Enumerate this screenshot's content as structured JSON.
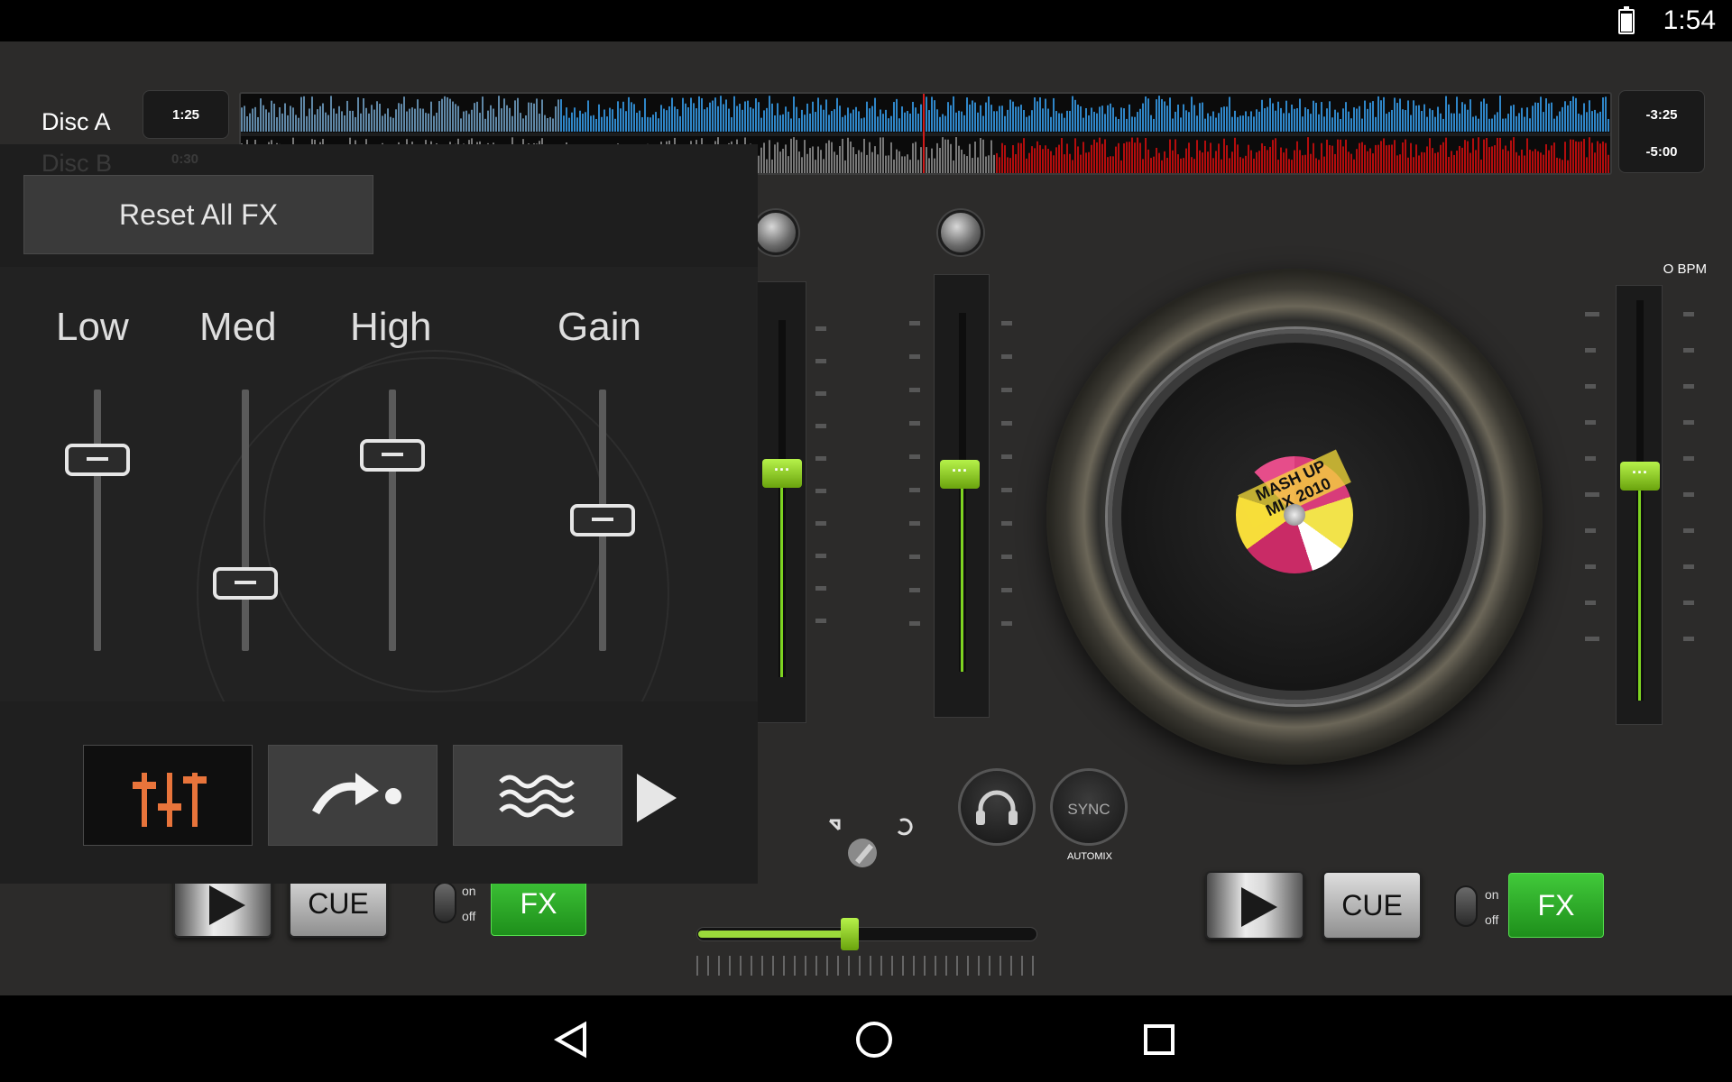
{
  "status_bar": {
    "time": "1:54"
  },
  "deck_a": {
    "name": "Disc A",
    "time_elapsed": "1:25",
    "time_remaining": "-3:25"
  },
  "deck_b": {
    "name": "Disc B",
    "time_elapsed": "0:30",
    "time_remaining": "-5:00",
    "bpm": "O BPM"
  },
  "fx_panel": {
    "reset_label": "Reset All FX",
    "eq_bands": [
      {
        "label": "Low",
        "level": 0.27
      },
      {
        "label": "Med",
        "level": 0.74
      },
      {
        "label": "High",
        "level": 0.25
      },
      {
        "label": "Gain",
        "level": 0.5
      }
    ],
    "tools": [
      {
        "icon": "eq-sliders-icon",
        "active": true
      },
      {
        "icon": "loop-arrow-icon",
        "active": false
      },
      {
        "icon": "waves-icon",
        "active": false
      }
    ]
  },
  "mixer": {
    "sync_label": "SYNC",
    "automix_label": "AUTOMIX",
    "crossfader_position": 0.45,
    "pitch_left_level": 0.57,
    "pitch_right_level": 0.55,
    "volume_right_level": 0.56
  },
  "controls": {
    "cue_label": "CUE",
    "fx_label": "FX",
    "toggle_on": "on",
    "toggle_off": "off"
  },
  "colors": {
    "accent": "#8ed22e",
    "fx_green": "#2aa626",
    "wave_a": "#2f86c8",
    "wave_b": "#b30d0d"
  }
}
